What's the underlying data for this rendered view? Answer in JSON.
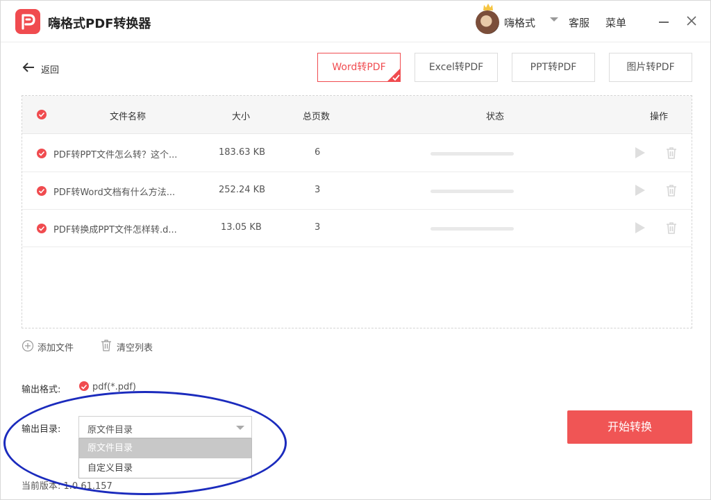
{
  "app": {
    "title": "嗨格式PDF转换器",
    "username": "嗨格式",
    "kefu_label": "客服",
    "menu_label": "菜单"
  },
  "colors": {
    "accent": "#f04b4f",
    "annotation": "#1b2bbd"
  },
  "nav": {
    "back_label": "返回"
  },
  "tabs": [
    {
      "label": "Word转PDF",
      "active": true
    },
    {
      "label": "Excel转PDF",
      "active": false
    },
    {
      "label": "PPT转PDF",
      "active": false
    },
    {
      "label": "图片转PDF",
      "active": false
    }
  ],
  "table": {
    "headers": {
      "name": "文件名称",
      "size": "大小",
      "pages": "总页数",
      "status": "状态",
      "actions": "操作"
    },
    "rows": [
      {
        "name": "PDF转PPT文件怎么转？这个...",
        "size": "183.63 KB",
        "pages": "6",
        "progress": 0
      },
      {
        "name": "PDF转Word文档有什么方法...",
        "size": "252.24 KB",
        "pages": "3",
        "progress": 0
      },
      {
        "name": "PDF转换成PPT文件怎样转.d...",
        "size": "13.05 KB",
        "pages": "3",
        "progress": 0
      }
    ]
  },
  "actions": {
    "add_file": "添加文件",
    "clear_list": "清空列表"
  },
  "output": {
    "format_label": "输出格式:",
    "format_value": "pdf(*.pdf)",
    "dir_label": "输出目录:",
    "dir_value": "原文件目录",
    "dir_options": [
      "原文件目录",
      "自定义目录"
    ]
  },
  "start_button": "开始转换",
  "version": "当前版本: 1.0.61.157"
}
